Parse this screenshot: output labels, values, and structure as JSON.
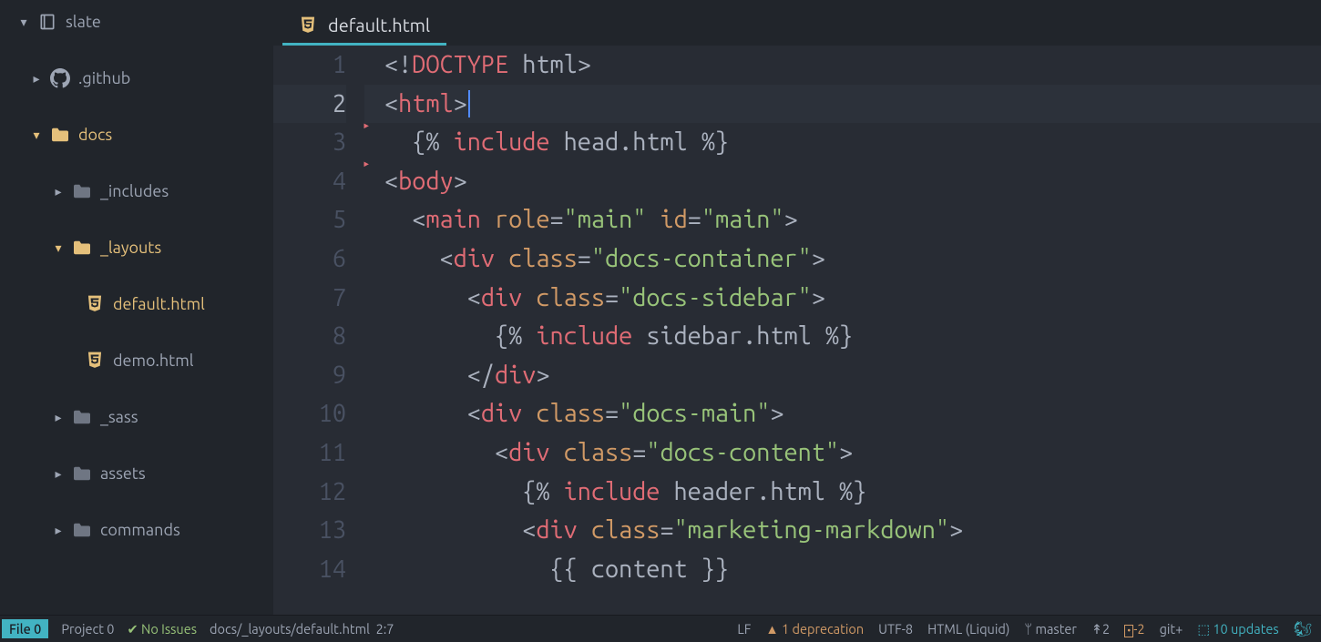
{
  "project": {
    "name": "slate"
  },
  "tree": [
    {
      "type": "root",
      "label": "slate"
    },
    {
      "type": "dir",
      "label": ".github",
      "expanded": false,
      "icon": "github"
    },
    {
      "type": "dir",
      "label": "docs",
      "expanded": true,
      "icon": "folder-open"
    },
    {
      "type": "dir",
      "label": "_includes",
      "expanded": false,
      "icon": "folder",
      "indent": 2
    },
    {
      "type": "dir",
      "label": "_layouts",
      "expanded": true,
      "icon": "folder-open",
      "indent": 2
    },
    {
      "type": "file",
      "label": "default.html",
      "icon": "html5",
      "indent": 3,
      "active": true
    },
    {
      "type": "file",
      "label": "demo.html",
      "icon": "html5",
      "indent": 3
    },
    {
      "type": "dir",
      "label": "_sass",
      "expanded": false,
      "icon": "folder",
      "indent": 2
    },
    {
      "type": "dir",
      "label": "assets",
      "expanded": false,
      "icon": "folder",
      "indent": 2
    },
    {
      "type": "dir",
      "label": "commands",
      "expanded": false,
      "icon": "folder",
      "indent": 2
    }
  ],
  "tab": {
    "filename": "default.html",
    "icon": "html5"
  },
  "code": {
    "lines": [
      "<!DOCTYPE html>",
      "<html>",
      "  {% include head.html %}",
      "<body>",
      "  <main role=\"main\" id=\"main\">",
      "    <div class=\"docs-container\">",
      "      <div class=\"docs-sidebar\">",
      "        {% include sidebar.html %}",
      "      </div>",
      "      <div class=\"docs-main\">",
      "        <div class=\"docs-content\">",
      "          {% include header.html %}",
      "          <div class=\"marketing-markdown\">",
      "            {{ content }}"
    ],
    "current_line": 2,
    "cursor_col": 7
  },
  "status": {
    "file_btn": "File 0",
    "project": "Project 0",
    "issues": "No Issues",
    "path": "docs/_layouts/default.html",
    "position": "2:7",
    "line_ending": "LF",
    "deprecation": "1 deprecation",
    "encoding": "UTF-8",
    "language": "HTML (Liquid)",
    "branch": "master",
    "ahead": "2",
    "behind": "-2",
    "git": "git+",
    "updates": "10 updates"
  }
}
